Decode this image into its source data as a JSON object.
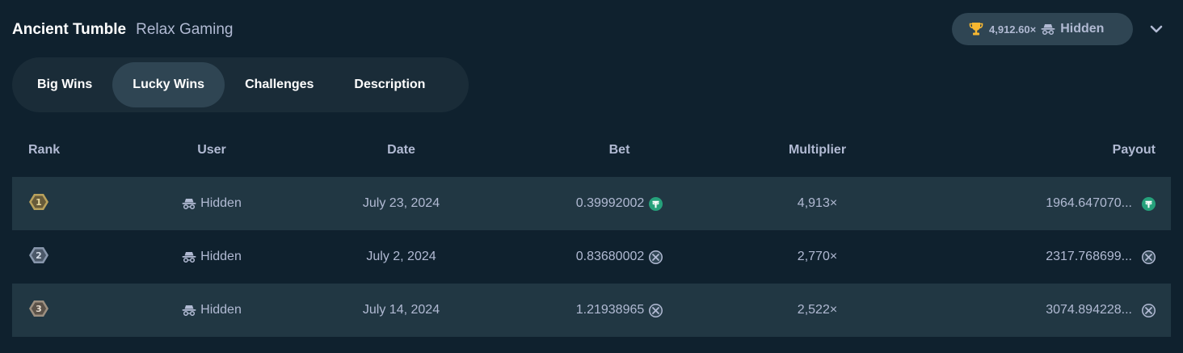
{
  "header": {
    "game_title": "Ancient Tumble",
    "provider": "Relax Gaming"
  },
  "record": {
    "icon": "trophy-icon",
    "multiplier": "4,912.60×",
    "user": "Hidden",
    "user_icon": "incognito-icon"
  },
  "tabs": [
    {
      "label": "Big Wins",
      "active": false
    },
    {
      "label": "Lucky Wins",
      "active": true
    },
    {
      "label": "Challenges",
      "active": false
    },
    {
      "label": "Description",
      "active": false
    }
  ],
  "table": {
    "headers": {
      "rank": "Rank",
      "user": "User",
      "date": "Date",
      "bet": "Bet",
      "multiplier": "Multiplier",
      "payout": "Payout"
    },
    "rows": [
      {
        "rank": "1",
        "user": "Hidden",
        "date": "July 23, 2024",
        "bet": "0.39992002",
        "multiplier": "4,913×",
        "payout": "1964.647070...",
        "currency": "usdt"
      },
      {
        "rank": "2",
        "user": "Hidden",
        "date": "July 2, 2024",
        "bet": "0.83680002",
        "multiplier": "2,770×",
        "payout": "2317.768699...",
        "currency": "xrp"
      },
      {
        "rank": "3",
        "user": "Hidden",
        "date": "July 14, 2024",
        "bet": "1.21938965",
        "multiplier": "2,522×",
        "payout": "3074.894228...",
        "currency": "xrp"
      }
    ]
  },
  "colors": {
    "background": "#0f212e",
    "panel": "#1a2c38",
    "row_alt": "#213743",
    "active": "#2f4553",
    "muted_text": "#b1bad3",
    "trophy": "#f7b731",
    "usdt": "#26a17b",
    "gold_medal": "#b8a15c",
    "silver_medal": "#8796ab",
    "bronze_medal": "#9c8f80"
  }
}
